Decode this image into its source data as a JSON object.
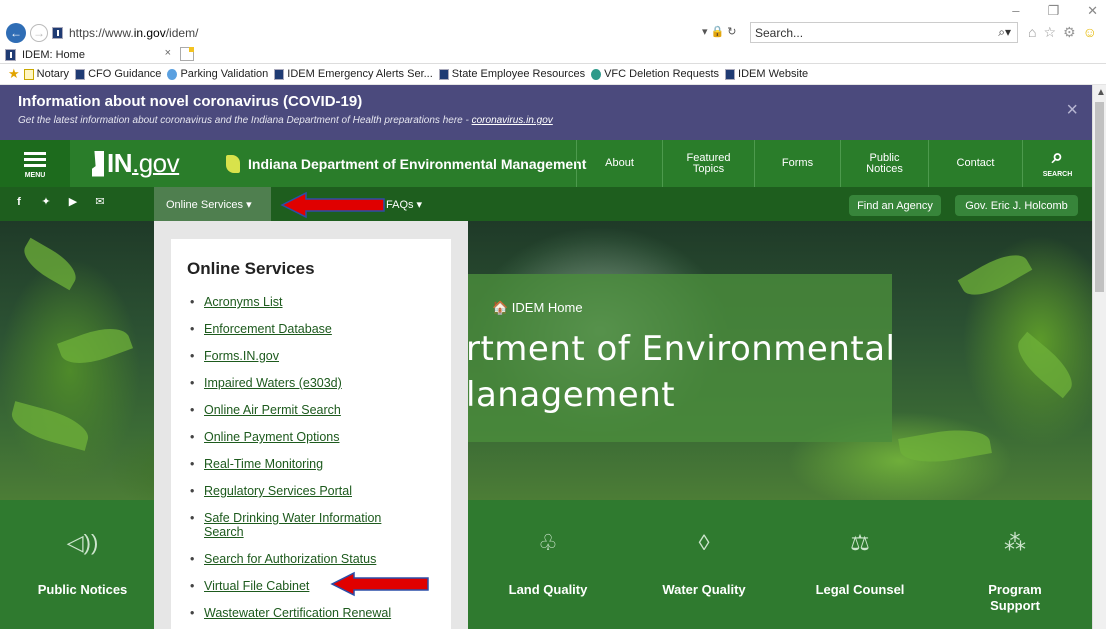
{
  "browser": {
    "url_prefix": "https://www.",
    "url_domain": "in.gov",
    "url_path": "/idem/",
    "search_placeholder": "Search...",
    "tab_title": "IDEM: Home",
    "favorites": [
      {
        "label": "Notary",
        "icon": "note"
      },
      {
        "label": "CFO Guidance",
        "icon": "doc"
      },
      {
        "label": "Parking Validation",
        "icon": "web"
      },
      {
        "label": "IDEM Emergency Alerts Ser...",
        "icon": "doc"
      },
      {
        "label": "State Employee Resources",
        "icon": "doc"
      },
      {
        "label": "VFC Deletion Requests",
        "icon": "green"
      },
      {
        "label": "IDEM Website",
        "icon": "doc"
      }
    ]
  },
  "covid": {
    "title": "Information about novel coronavirus (COVID-19)",
    "subtitle": "Get the latest information about coronavirus and the Indiana Department of Health preparations here - ",
    "link": "coronavirus.in.gov",
    "close": "×"
  },
  "header": {
    "menu_label": "MENU",
    "logo_text": "IN",
    "logo_gov": ".gov",
    "agency": "Indiana Department of Environmental Management",
    "nav": [
      {
        "label": "About",
        "width": 86
      },
      {
        "label": "Featured Topics",
        "width": 92
      },
      {
        "label": "Forms",
        "width": 86
      },
      {
        "label": "Public Notices",
        "width": 88
      },
      {
        "label": "Contact",
        "width": 94
      }
    ],
    "search_label": "SEARCH"
  },
  "subnav": {
    "online_services": "Online Services ▾",
    "faqs": "FAQs ▾",
    "find_agency": "Find an Agency",
    "governor": "Gov. Eric J. Holcomb"
  },
  "hero": {
    "crumb": "🏠 IDEM Home",
    "title_line1": "rtment of Environmental",
    "title_line2": "lanagement"
  },
  "dropdown": {
    "title": "Online Services",
    "items": [
      "Acronyms List",
      "Enforcement Database",
      "Forms.IN.gov",
      "Impaired Waters (e303d)",
      "Online Air Permit Search",
      "Online Payment Options",
      "Real-Time Monitoring",
      "Regulatory Services Portal",
      "Safe Drinking Water Information Search",
      "Search for Authorization Status",
      "Virtual File Cabinet",
      "Wastewater Certification Renewal"
    ]
  },
  "tiles": [
    {
      "label": "Public Notices",
      "icon": "speaker-icon",
      "glyph": "🔈"
    },
    {
      "label": "Land Quality",
      "icon": "sprout-icon",
      "glyph": "⚘"
    },
    {
      "label": "Water Quality",
      "icon": "water-drop-icon",
      "glyph": "💧"
    },
    {
      "label": "Legal Counsel",
      "icon": "scales-icon",
      "glyph": "⚖"
    },
    {
      "label": "Program Support",
      "icon": "network-icon",
      "glyph": "⚛"
    }
  ],
  "colors": {
    "covid_bg": "#4b4a7d",
    "nav_green": "#2a7d2a",
    "subnav_green": "#1e5e1e",
    "arrow_red": "#e00000"
  }
}
